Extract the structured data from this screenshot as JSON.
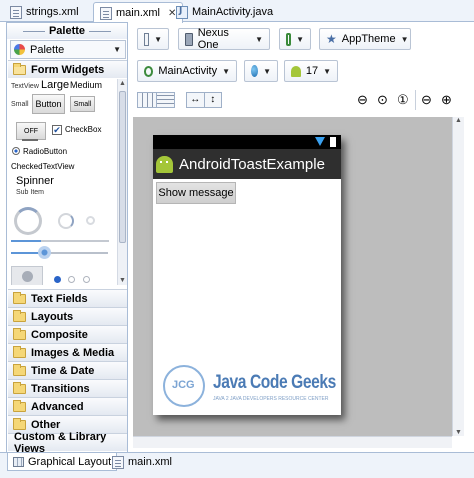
{
  "tabs": [
    {
      "label": "strings.xml"
    },
    {
      "label": "main.xml"
    },
    {
      "label": "MainActivity.java"
    }
  ],
  "palette": {
    "title": "Palette",
    "selector_value": "Palette",
    "form_widgets": "Form Widgets",
    "widgets": {
      "textview": "TextView",
      "large": "Large",
      "medium": "Medium",
      "small": "Small",
      "button": "Button",
      "small_button": "Small",
      "toggle_off": "OFF",
      "checkbox": "CheckBox",
      "radiobutton": "RadioButton",
      "checkedtextview": "CheckedTextView",
      "spinner": "Spinner",
      "sub_item": "Sub Item"
    },
    "categories": [
      "Text Fields",
      "Layouts",
      "Composite",
      "Images & Media",
      "Time & Date",
      "Transitions",
      "Advanced",
      "Other",
      "Custom & Library Views"
    ]
  },
  "toolbar": {
    "device": "Nexus One",
    "theme": "AppTheme",
    "activity": "MainActivity",
    "api_level": "17"
  },
  "preview": {
    "app_title": "AndroidToastExample",
    "button_label": "Show message",
    "watermark_main": "Java Code Geeks",
    "watermark_sub": "JAVA 2 JAVA DEVELOPERS RESOURCE CENTER",
    "watermark_logo_text": "JCG"
  },
  "bottom_tabs": [
    {
      "label": "Graphical Layout"
    },
    {
      "label": "main.xml"
    }
  ],
  "colors": {
    "accent_folder": "#f5d777",
    "actionbar": "#2f2f2f",
    "android_green": "#a4c639",
    "watermark_blue": "#4b7bb5"
  }
}
